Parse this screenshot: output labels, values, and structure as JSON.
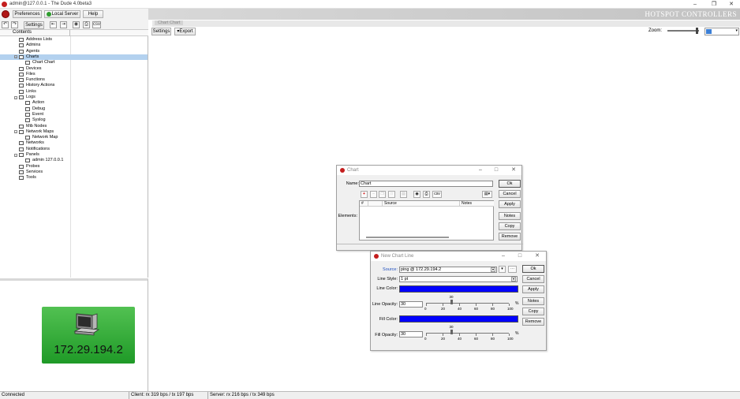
{
  "window": {
    "title": "admin@127.0.0.1 - The Dude 4.0beta3"
  },
  "menu": {
    "preferences": "Preferences",
    "local_server": "Local Server",
    "help": "Help"
  },
  "toolbar": {
    "settings": "Settings",
    "csv": "csv"
  },
  "hotspot": "HOTSPOT CONTROLLERS",
  "tree": {
    "header": "Contents",
    "items": [
      {
        "label": "Address Lists",
        "depth": 1,
        "icon": "list-icon"
      },
      {
        "label": "Admins",
        "depth": 1,
        "icon": "admin-icon"
      },
      {
        "label": "Agents",
        "depth": 1,
        "icon": "agent-icon"
      },
      {
        "label": "Charts",
        "depth": 1,
        "icon": "chart-icon",
        "expanded": "-",
        "selected": true
      },
      {
        "label": "Chart Chart",
        "depth": 2,
        "icon": "chart-icon"
      },
      {
        "label": "Devices",
        "depth": 1,
        "icon": "device-icon"
      },
      {
        "label": "Files",
        "depth": 1,
        "icon": "folder-icon"
      },
      {
        "label": "Functions",
        "depth": 1,
        "icon": "function-icon"
      },
      {
        "label": "History Actions",
        "depth": 1,
        "icon": "history-icon"
      },
      {
        "label": "Links",
        "depth": 1,
        "icon": "link-icon"
      },
      {
        "label": "Logs",
        "depth": 1,
        "icon": "log-icon",
        "expanded": "-"
      },
      {
        "label": "Action",
        "depth": 2,
        "icon": "log-icon"
      },
      {
        "label": "Debug",
        "depth": 2,
        "icon": "log-icon"
      },
      {
        "label": "Event",
        "depth": 2,
        "icon": "log-icon"
      },
      {
        "label": "Syslog",
        "depth": 2,
        "icon": "log-icon"
      },
      {
        "label": "Mib Nodes",
        "depth": 1,
        "icon": "mib-icon"
      },
      {
        "label": "Network Maps",
        "depth": 1,
        "icon": "map-icon",
        "expanded": "-"
      },
      {
        "label": "Network Map",
        "depth": 2,
        "icon": "map-icon"
      },
      {
        "label": "Networks",
        "depth": 1,
        "icon": "network-icon"
      },
      {
        "label": "Notifications",
        "depth": 1,
        "icon": "notification-icon"
      },
      {
        "label": "Panels",
        "depth": 1,
        "icon": "panel-icon",
        "expanded": "-"
      },
      {
        "label": "admin 127.0.0.1",
        "depth": 2,
        "icon": "panel-icon"
      },
      {
        "label": "Probes",
        "depth": 1,
        "icon": "probe-icon"
      },
      {
        "label": "Services",
        "depth": 1,
        "icon": "service-icon"
      },
      {
        "label": "Tools",
        "depth": 1,
        "icon": "tool-icon"
      }
    ]
  },
  "device": {
    "ip": "172.29.194.2"
  },
  "main": {
    "tab": "Chart Chart",
    "settings": "Settings",
    "export": "Export",
    "zoom_label": "Zoom:"
  },
  "status": {
    "connection": "Connected",
    "client": "Client: rx 319 bps / tx 197 bps",
    "server": "Server: rx 216 bps / tx 349 bps"
  },
  "chart_dialog": {
    "title": "Chart",
    "name_label": "Name:",
    "name_value": "Chart",
    "elements_label": "Elements:",
    "columns": [
      "#",
      "",
      "Source",
      "Notes"
    ],
    "ok": "Ok",
    "cancel": "Cancel",
    "apply": "Apply",
    "notes": "Notes",
    "copy": "Copy",
    "remove": "Remove"
  },
  "line_dialog": {
    "title": "New Chart Line",
    "source_label": "Source:",
    "source_value": "ping @ 172.29.194.2",
    "line_style_label": "Line Style:",
    "line_style_value": "1 pt",
    "line_color_label": "Line Color:",
    "line_color": "#0000ff",
    "line_opacity_label": "Line Opacity:",
    "line_opacity_value": "30",
    "fill_color_label": "Fill Color:",
    "fill_color": "#0000ff",
    "fill_opacity_label": "Fill Opacity:",
    "fill_opacity_value": "30",
    "scale": [
      "0",
      "20",
      "40",
      "60",
      "80",
      "100"
    ],
    "knob_value": "30",
    "pct": "%",
    "ok": "Ok",
    "cancel": "Cancel",
    "apply": "Apply",
    "notes": "Notes",
    "copy": "Copy",
    "remove": "Remove"
  }
}
